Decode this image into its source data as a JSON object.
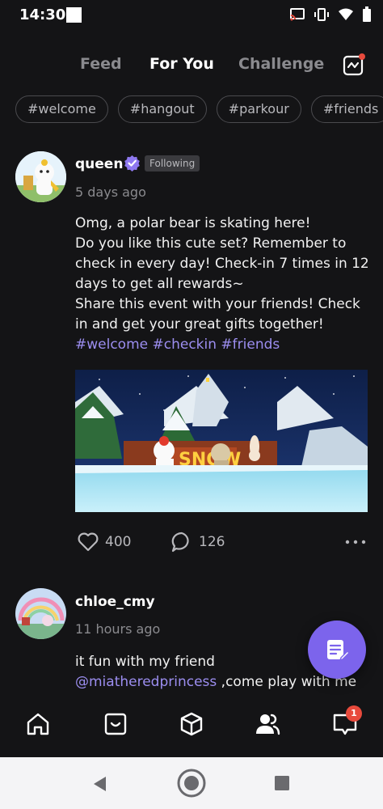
{
  "status_bar": {
    "time": "14:30"
  },
  "top_nav": {
    "tabs": [
      {
        "label": "Feed",
        "active": false
      },
      {
        "label": "For You",
        "active": true
      },
      {
        "label": "Challenge",
        "active": false
      }
    ]
  },
  "hashtag_filters": [
    "#welcome",
    "#hangout",
    "#parkour",
    "#friends"
  ],
  "posts": [
    {
      "username": "queen",
      "verified": true,
      "badge": "Following",
      "time": "5 days ago",
      "text_lines": [
        "Omg, a polar bear is skating here!",
        "Do you like this cute set? Remember to",
        "check in every day! Check-in 7 times in 12",
        "days to get all rewards~",
        "Share this event with your friends! Check",
        "in and get your great gifts together!"
      ],
      "hashtags": "#welcome #checkin #friends",
      "image_sign": "SNOW",
      "likes": "400",
      "comments": "126"
    },
    {
      "username": "chloe_cmy",
      "time": "11 hours ago",
      "text_line1": "it fun with my friend",
      "mention": "@miatheredprincess",
      "text_line2_rest": " ,come play with me"
    }
  ],
  "bottom_nav": {
    "items": [
      "home-icon",
      "inbox-icon",
      "cube-icon",
      "friends-icon",
      "messages-icon"
    ],
    "messages_badge": "1"
  },
  "colors": {
    "accent": "#7c64ec",
    "link": "#9c8ef0",
    "background": "#141416",
    "badge": "#e84a3c"
  }
}
